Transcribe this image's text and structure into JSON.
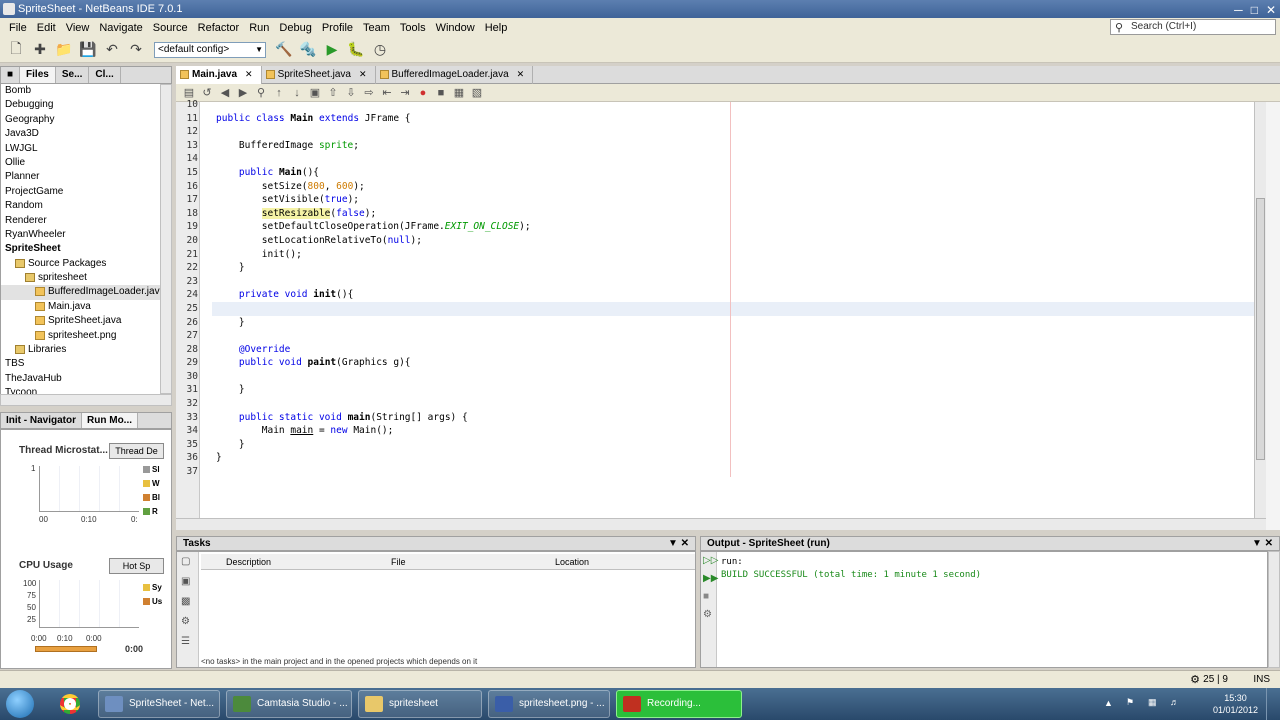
{
  "window": {
    "title": "SpriteSheet - NetBeans IDE 7.0.1"
  },
  "menubar": {
    "items": [
      "File",
      "Edit",
      "View",
      "Navigate",
      "Source",
      "Refactor",
      "Run",
      "Debug",
      "Profile",
      "Team",
      "Tools",
      "Window",
      "Help"
    ]
  },
  "search": {
    "placeholder": "Search (Ctrl+I)"
  },
  "toolbar": {
    "config": "<default config>"
  },
  "projects": {
    "tabs": [
      "Files",
      "Se...",
      "Cl..."
    ],
    "tree": [
      {
        "label": "Bomb",
        "indent": 0,
        "bold": false
      },
      {
        "label": "Debugging",
        "indent": 0,
        "bold": false
      },
      {
        "label": "Geography",
        "indent": 0,
        "bold": false
      },
      {
        "label": "Java3D",
        "indent": 0,
        "bold": false
      },
      {
        "label": "LWJGL",
        "indent": 0,
        "bold": false
      },
      {
        "label": "Ollie",
        "indent": 0,
        "bold": false
      },
      {
        "label": "Planner",
        "indent": 0,
        "bold": false
      },
      {
        "label": "ProjectGame",
        "indent": 0,
        "bold": false
      },
      {
        "label": "Random",
        "indent": 0,
        "bold": false
      },
      {
        "label": "Renderer",
        "indent": 0,
        "bold": false
      },
      {
        "label": "RyanWheeler",
        "indent": 0,
        "bold": false
      },
      {
        "label": "SpriteSheet",
        "indent": 0,
        "bold": true
      },
      {
        "label": "Source Packages",
        "indent": 1,
        "bold": false
      },
      {
        "label": "spritesheet",
        "indent": 2,
        "bold": false
      },
      {
        "label": "BufferedImageLoader.java",
        "indent": 3,
        "bold": false,
        "selected": true
      },
      {
        "label": "Main.java",
        "indent": 3,
        "bold": false
      },
      {
        "label": "SpriteSheet.java",
        "indent": 3,
        "bold": false
      },
      {
        "label": "spritesheet.png",
        "indent": 3,
        "bold": false
      },
      {
        "label": "Libraries",
        "indent": 1,
        "bold": false
      },
      {
        "label": "TBS",
        "indent": 0,
        "bold": false
      },
      {
        "label": "TheJavaHub",
        "indent": 0,
        "bold": false
      },
      {
        "label": "Tycoon",
        "indent": 0,
        "bold": false
      }
    ]
  },
  "navigator": {
    "tabs": [
      "Init - Navigator",
      "Run Mo..."
    ],
    "thread": {
      "label": "Thread Microstat...",
      "button": "Thread De",
      "ymax": "1",
      "t0": "00",
      "t1": "0:10",
      "t2": "0:",
      "legend": [
        "Sl",
        "W",
        "Bl",
        "R"
      ]
    },
    "cpu": {
      "label": "CPU Usage",
      "button": "Hot Sp",
      "ticks": [
        "100",
        "75",
        "50",
        "25"
      ],
      "t0": "0:00",
      "t1": "0:10",
      "t2": "0:00",
      "legend": [
        "Sy",
        "Us"
      ],
      "time": "0:00"
    }
  },
  "editor": {
    "tabs": [
      "Main.java",
      "SpriteSheet.java",
      "BufferedImageLoader.java"
    ],
    "lines": [
      {
        "n": "10",
        "html": ""
      },
      {
        "n": "11",
        "html": "<span class='kw'>public class</span> <b>Main</b> <span class='kw'>extends</span> JFrame {"
      },
      {
        "n": "12",
        "html": ""
      },
      {
        "n": "13",
        "html": "    BufferedImage <span class='fld'>sprite</span>;"
      },
      {
        "n": "14",
        "html": ""
      },
      {
        "n": "15",
        "html": "    <span class='kw'>public</span> <b>Main</b>(){"
      },
      {
        "n": "16",
        "html": "        setSize(<span class='str'>800</span>, <span class='str'>600</span>);"
      },
      {
        "n": "17",
        "html": "        setVisible(<span class='kw'>true</span>);"
      },
      {
        "n": "18",
        "html": "        <span class='hl'>setResizable</span>(<span class='kw'>false</span>);"
      },
      {
        "n": "19",
        "html": "        setDefaultCloseOperation(JFrame.<span class='it'>EXIT_ON_CLOSE</span>);"
      },
      {
        "n": "20",
        "html": "        setLocationRelativeTo(<span class='kw'>null</span>);"
      },
      {
        "n": "21",
        "html": "        init();"
      },
      {
        "n": "22",
        "html": "    }"
      },
      {
        "n": "23",
        "html": ""
      },
      {
        "n": "24",
        "html": "    <span class='kw'>private void</span> <b>init</b>(){"
      },
      {
        "n": "25",
        "html": "",
        "current": true
      },
      {
        "n": "26",
        "html": "    }"
      },
      {
        "n": "27",
        "html": ""
      },
      {
        "n": "28",
        "html": "    <span class='kw'>@Override</span>"
      },
      {
        "n": "29",
        "html": "    <span class='kw'>public void</span> <b>paint</b>(Graphics g){"
      },
      {
        "n": "30",
        "html": ""
      },
      {
        "n": "31",
        "html": "    }"
      },
      {
        "n": "32",
        "html": ""
      },
      {
        "n": "33",
        "html": "    <span class='kw'>public static void</span> <b>main</b>(String[] args) {"
      },
      {
        "n": "34",
        "html": "        Main <u>main</u> = <span class='kw'>new</span> Main();"
      },
      {
        "n": "35",
        "html": "    }"
      },
      {
        "n": "36",
        "html": "}"
      },
      {
        "n": "37",
        "html": ""
      }
    ]
  },
  "tasks": {
    "title": "Tasks",
    "columns": [
      "Description",
      "File",
      "Location"
    ],
    "footer": "<no tasks> in the main project and in the opened projects which depends on it"
  },
  "output": {
    "title": "Output - SpriteSheet (run)",
    "lines": [
      "run:",
      "BUILD SUCCESSFUL (total time: 1 minute 1 second)"
    ]
  },
  "status": {
    "position": "25 | 9",
    "mode": "INS"
  },
  "taskbar": {
    "apps": [
      {
        "label": "SpriteSheet - Net...",
        "color": "#6e8fc0"
      },
      {
        "label": "Camtasia Studio - ...",
        "color": "#4c8a3c"
      },
      {
        "label": "spritesheet",
        "color": "#e8c86a"
      },
      {
        "label": "spritesheet.png - ...",
        "color": "#3a5ea8"
      },
      {
        "label": "Recording...",
        "color": "#c03020"
      }
    ],
    "clock": {
      "time": "15:30",
      "date": "01/01/2012"
    }
  }
}
